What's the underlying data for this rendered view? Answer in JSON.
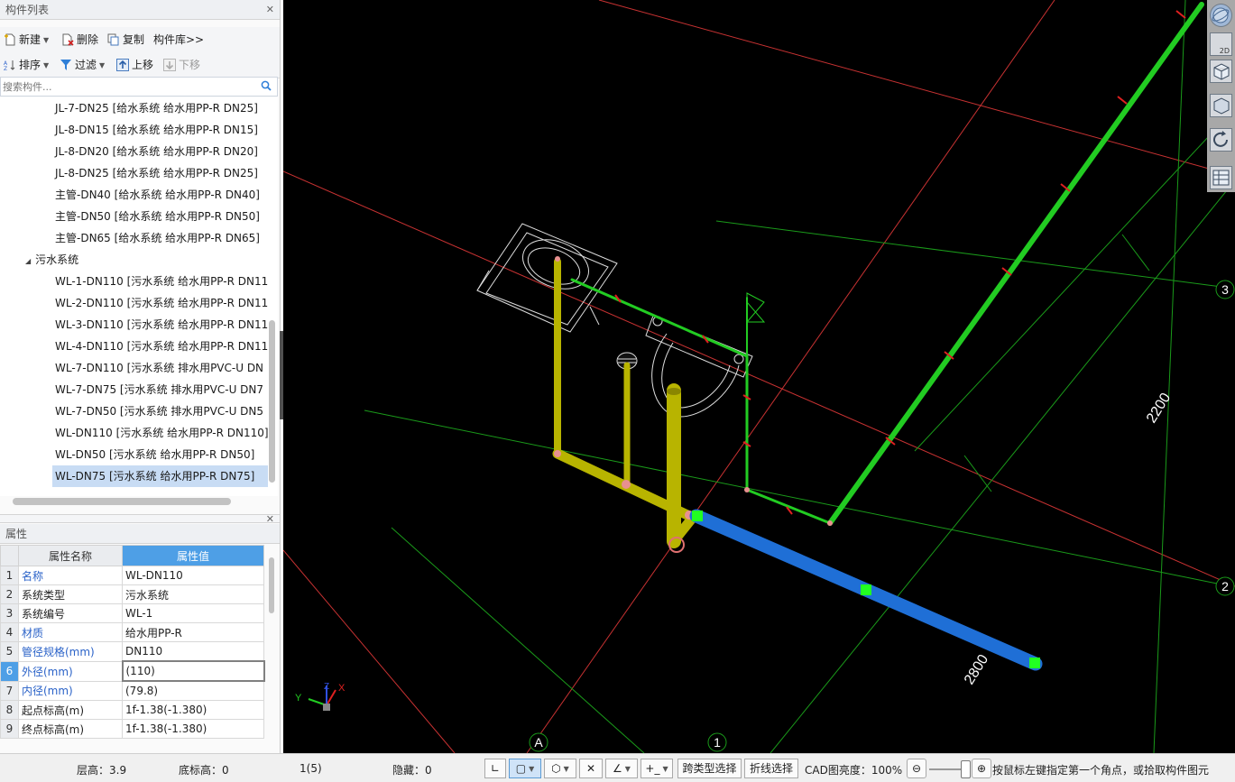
{
  "component_panel": {
    "title": "构件列表",
    "toolbar1": {
      "new": "新建",
      "delete": "删除",
      "copy": "复制",
      "library": "构件库>>"
    },
    "toolbar2": {
      "sort": "排序",
      "filter": "过滤",
      "move_up": "上移",
      "move_down": "下移"
    },
    "search_placeholder": "搜索构件...",
    "tree": {
      "group_label": "污水系统",
      "items_before": [
        "JL-7-DN25 [给水系统 给水用PP-R DN25]",
        "JL-8-DN15 [给水系统 给水用PP-R DN15]",
        "JL-8-DN20 [给水系统 给水用PP-R DN20]",
        "JL-8-DN25 [给水系统 给水用PP-R DN25]",
        "主管-DN40 [给水系统 给水用PP-R DN40]",
        "主管-DN50 [给水系统 给水用PP-R DN50]",
        "主管-DN65 [给水系统 给水用PP-R DN65]"
      ],
      "items_after": [
        "WL-1-DN110 [污水系统 给水用PP-R DN11",
        "WL-2-DN110 [污水系统 给水用PP-R DN11",
        "WL-3-DN110 [污水系统 给水用PP-R DN11",
        "WL-4-DN110 [污水系统 给水用PP-R DN11",
        "WL-7-DN110 [污水系统 排水用PVC-U DN",
        "WL-7-DN75 [污水系统 排水用PVC-U DN7",
        "WL-7-DN50 [污水系统 排水用PVC-U DN5",
        "WL-DN110 [污水系统 给水用PP-R DN110]",
        "WL-DN50 [污水系统 给水用PP-R DN50]",
        "WL-DN75 [污水系统 给水用PP-R DN75]"
      ]
    }
  },
  "properties_panel": {
    "title": "属性",
    "col_name": "属性名称",
    "col_value": "属性值",
    "rows": [
      {
        "idx": "1",
        "name": "名称",
        "value": "WL-DN110"
      },
      {
        "idx": "2",
        "name": "系统类型",
        "value": "污水系统"
      },
      {
        "idx": "3",
        "name": "系统编号",
        "value": "WL-1"
      },
      {
        "idx": "4",
        "name": "材质",
        "value": "给水用PP-R"
      },
      {
        "idx": "5",
        "name": "管径规格(mm)",
        "value": "DN110"
      },
      {
        "idx": "6",
        "name": "外径(mm)",
        "value": "(110)"
      },
      {
        "idx": "7",
        "name": "内径(mm)",
        "value": "(79.8)"
      },
      {
        "idx": "8",
        "name": "起点标高(m)",
        "value": "1f-1.38(-1.380)"
      },
      {
        "idx": "9",
        "name": "终点标高(m)",
        "value": "1f-1.38(-1.380)"
      }
    ]
  },
  "viewport": {
    "axis_labels": {
      "a": "A",
      "one": "1",
      "two": "2",
      "three": "3"
    },
    "dimensions": {
      "d2200": "2200",
      "d2800": "2800"
    },
    "triad": {
      "x": "X",
      "y": "Y",
      "z": "Z"
    },
    "view_toolbar": {
      "view2d": "2D"
    }
  },
  "status_bar": {
    "floor_height": "层高：3.9",
    "base_elevation": "底标高：0",
    "count": "1(5)",
    "hidden": "隐藏：0",
    "cross_type_select": "跨类型选择",
    "polyline_select": "折线选择",
    "cad_brightness": "CAD图亮度：100%",
    "hint": "按鼠标左键指定第一个角点，或拾取构件图元"
  },
  "colors": {
    "viewport_bg": "#000000",
    "grid_red": "#c83232",
    "grid_green": "#1a9a1a",
    "pipe_green": "#22cc22",
    "pipe_yellow": "#b8b400",
    "pipe_blue": "#1f6fd6",
    "selection_blue": "#4e9fe6"
  }
}
